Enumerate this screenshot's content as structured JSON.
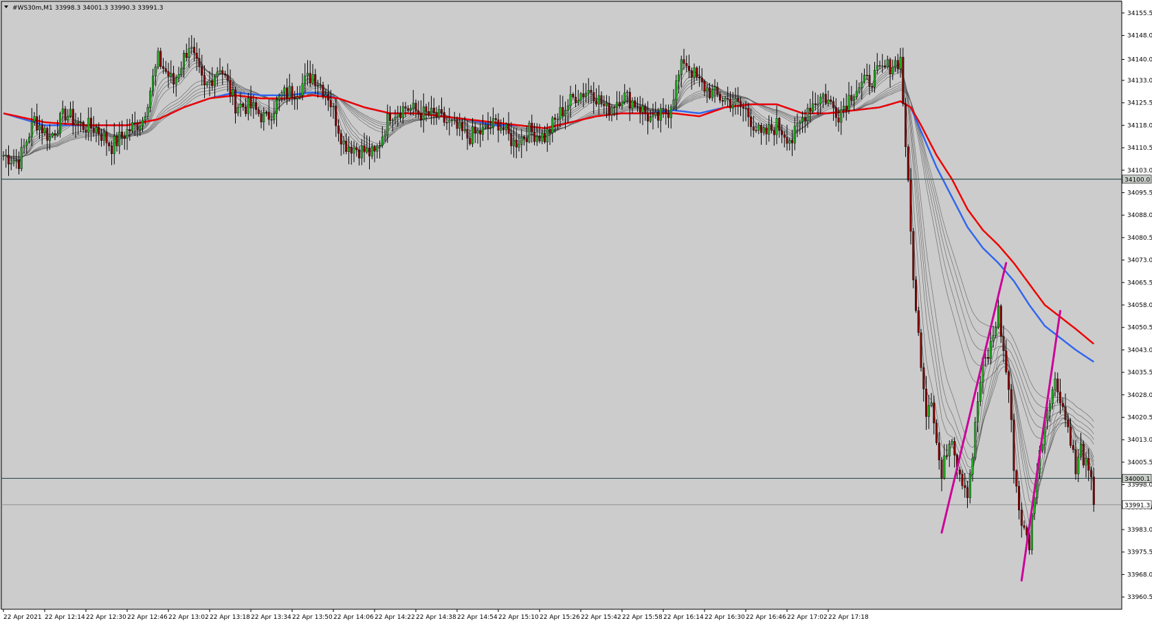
{
  "window": {
    "symbol_timeframe": "#WS30m,M1",
    "ohlc_readout": "33998.3 34001.3 33990.3 33991.3",
    "menu_icon": "triangle-down-icon"
  },
  "colors": {
    "background": "#cccccc",
    "ema_fast": "#ee0000",
    "ema_slow": "#3366ee",
    "guppy": "#555555",
    "bull_candle": "#22aa22",
    "bear_candle": "#880000",
    "wick": "#000000",
    "trendline": "#cc0099",
    "level_line": "#2f4f4f"
  },
  "chart_data": {
    "type": "candlestick",
    "title": "#WS30m,M1",
    "ylim": [
      33958.0,
      34158.0
    ],
    "y_ticks": [
      "34155.5",
      "34148.0",
      "34140.0",
      "34133.0",
      "34125.5",
      "34118.0",
      "34110.5",
      "34103.0",
      "34095.5",
      "34088.0",
      "34080.5",
      "34073.0",
      "34065.5",
      "34058.0",
      "34050.5",
      "34043.0",
      "34035.5",
      "34028.0",
      "34020.5",
      "34013.0",
      "34005.5",
      "33998.0",
      "33990.5",
      "33983.0",
      "33975.5",
      "33968.0",
      "33960.5"
    ],
    "x_ticks": [
      "22 Apr 2021",
      "22 Apr 12:14",
      "22 Apr 12:30",
      "22 Apr 12:46",
      "22 Apr 13:02",
      "22 Apr 13:18",
      "22 Apr 13:34",
      "22 Apr 13:50",
      "22 Apr 14:06",
      "22 Apr 14:22",
      "22 Apr 14:38",
      "22 Apr 14:54",
      "22 Apr 15:10",
      "22 Apr 15:26",
      "22 Apr 15:42",
      "22 Apr 15:58",
      "22 Apr 16:14",
      "22 Apr 16:30",
      "22 Apr 16:46",
      "22 Apr 17:02",
      "22 Apr 17:18"
    ],
    "bars_per_tick": 16,
    "horizontal_levels": [
      {
        "price": 34100.0,
        "label": "34100.0"
      },
      {
        "price": 34000.1,
        "label": "34000.1"
      }
    ],
    "current_price": {
      "price": 33991.3,
      "label": "33991.3"
    },
    "close_path": [
      [
        0,
        34108
      ],
      [
        6,
        34106
      ],
      [
        12,
        34120
      ],
      [
        18,
        34114
      ],
      [
        24,
        34122
      ],
      [
        30,
        34118
      ],
      [
        36,
        34117
      ],
      [
        42,
        34111
      ],
      [
        48,
        34116
      ],
      [
        54,
        34120
      ],
      [
        60,
        34140
      ],
      [
        66,
        34132
      ],
      [
        72,
        34145
      ],
      [
        78,
        34130
      ],
      [
        84,
        34138
      ],
      [
        90,
        34125
      ],
      [
        96,
        34124
      ],
      [
        102,
        34120
      ],
      [
        108,
        34128
      ],
      [
        114,
        34130
      ],
      [
        120,
        34135
      ],
      [
        126,
        34128
      ],
      [
        132,
        34112
      ],
      [
        138,
        34110
      ],
      [
        144,
        34108
      ],
      [
        150,
        34122
      ],
      [
        156,
        34124
      ],
      [
        162,
        34122
      ],
      [
        168,
        34121
      ],
      [
        174,
        34118
      ],
      [
        180,
        34114
      ],
      [
        186,
        34116
      ],
      [
        192,
        34119
      ],
      [
        198,
        34112
      ],
      [
        204,
        34116
      ],
      [
        210,
        34114
      ],
      [
        216,
        34122
      ],
      [
        222,
        34128
      ],
      [
        228,
        34130
      ],
      [
        234,
        34123
      ],
      [
        240,
        34128
      ],
      [
        246,
        34125
      ],
      [
        252,
        34119
      ],
      [
        258,
        34123
      ],
      [
        264,
        34140
      ],
      [
        270,
        34132
      ],
      [
        276,
        34128
      ],
      [
        282,
        34126
      ],
      [
        288,
        34123
      ],
      [
        294,
        34114
      ],
      [
        300,
        34118
      ],
      [
        306,
        34113
      ],
      [
        312,
        34124
      ],
      [
        318,
        34128
      ],
      [
        324,
        34122
      ],
      [
        330,
        34130
      ],
      [
        336,
        34133
      ],
      [
        342,
        34137
      ],
      [
        348,
        34140
      ],
      [
        350,
        34112
      ],
      [
        352,
        34082
      ],
      [
        354,
        34055
      ],
      [
        356,
        34040
      ],
      [
        358,
        34023
      ],
      [
        360,
        34028
      ],
      [
        362,
        34012
      ],
      [
        364,
        34000
      ],
      [
        366,
        34010
      ],
      [
        368,
        34015
      ],
      [
        370,
        34005
      ],
      [
        372,
        34000
      ],
      [
        374,
        33996
      ],
      [
        376,
        34008
      ],
      [
        378,
        34026
      ],
      [
        380,
        34038
      ],
      [
        382,
        34041
      ],
      [
        384,
        34048
      ],
      [
        386,
        34056
      ],
      [
        388,
        34042
      ],
      [
        390,
        34030
      ],
      [
        392,
        34005
      ],
      [
        394,
        33990
      ],
      [
        396,
        33982
      ],
      [
        398,
        33978
      ],
      [
        400,
        33996
      ],
      [
        402,
        34008
      ],
      [
        404,
        34020
      ],
      [
        406,
        34028
      ],
      [
        408,
        34032
      ],
      [
        410,
        34028
      ],
      [
        412,
        34020
      ],
      [
        414,
        34014
      ],
      [
        416,
        34002
      ],
      [
        418,
        34010
      ],
      [
        420,
        34004
      ],
      [
        422,
        33998
      ],
      [
        423,
        33991.3
      ]
    ],
    "ema_fast": [
      [
        0,
        34122
      ],
      [
        16,
        34119
      ],
      [
        32,
        34118
      ],
      [
        48,
        34118
      ],
      [
        60,
        34120
      ],
      [
        70,
        34124
      ],
      [
        80,
        34127
      ],
      [
        90,
        34128
      ],
      [
        100,
        34127
      ],
      [
        110,
        34127
      ],
      [
        120,
        34128
      ],
      [
        130,
        34127
      ],
      [
        140,
        34124
      ],
      [
        150,
        34122
      ],
      [
        160,
        34122
      ],
      [
        170,
        34121
      ],
      [
        180,
        34120
      ],
      [
        190,
        34119
      ],
      [
        200,
        34118
      ],
      [
        210,
        34117
      ],
      [
        220,
        34119
      ],
      [
        230,
        34121
      ],
      [
        240,
        34122
      ],
      [
        250,
        34122
      ],
      [
        260,
        34122
      ],
      [
        270,
        34121
      ],
      [
        280,
        34124
      ],
      [
        290,
        34125
      ],
      [
        300,
        34125
      ],
      [
        310,
        34122
      ],
      [
        320,
        34122
      ],
      [
        330,
        34123
      ],
      [
        340,
        34124
      ],
      [
        348,
        34126
      ],
      [
        352,
        34124
      ],
      [
        356,
        34118
      ],
      [
        362,
        34108
      ],
      [
        368,
        34100
      ],
      [
        374,
        34090
      ],
      [
        380,
        34083
      ],
      [
        386,
        34078
      ],
      [
        392,
        34072
      ],
      [
        398,
        34065
      ],
      [
        404,
        34058
      ],
      [
        410,
        34054
      ],
      [
        416,
        34050
      ],
      [
        423,
        34045
      ]
    ],
    "ema_slow": [
      [
        0,
        34122
      ],
      [
        16,
        34118
      ],
      [
        32,
        34118
      ],
      [
        48,
        34118
      ],
      [
        60,
        34120
      ],
      [
        70,
        34124
      ],
      [
        80,
        34127
      ],
      [
        90,
        34129
      ],
      [
        100,
        34128
      ],
      [
        110,
        34128
      ],
      [
        120,
        34129
      ],
      [
        130,
        34127
      ],
      [
        140,
        34124
      ],
      [
        150,
        34122
      ],
      [
        160,
        34122
      ],
      [
        170,
        34121
      ],
      [
        180,
        34120
      ],
      [
        190,
        34118
      ],
      [
        200,
        34118
      ],
      [
        210,
        34117
      ],
      [
        220,
        34119
      ],
      [
        230,
        34121
      ],
      [
        240,
        34122
      ],
      [
        250,
        34122
      ],
      [
        260,
        34123
      ],
      [
        270,
        34122
      ],
      [
        280,
        34124
      ],
      [
        290,
        34125
      ],
      [
        300,
        34125
      ],
      [
        310,
        34122
      ],
      [
        320,
        34122
      ],
      [
        330,
        34123
      ],
      [
        340,
        34124
      ],
      [
        348,
        34126
      ],
      [
        352,
        34124
      ],
      [
        356,
        34116
      ],
      [
        362,
        34104
      ],
      [
        368,
        34094
      ],
      [
        374,
        34084
      ],
      [
        380,
        34077
      ],
      [
        386,
        34072
      ],
      [
        392,
        34066
      ],
      [
        398,
        34058
      ],
      [
        404,
        34051
      ],
      [
        410,
        34047
      ],
      [
        416,
        34043
      ],
      [
        423,
        34039
      ]
    ],
    "trendlines": [
      {
        "x1": 364,
        "y1": 33982,
        "x2": 389,
        "y2": 34072
      },
      {
        "x1": 395,
        "y1": 33966,
        "x2": 410,
        "y2": 34056
      }
    ]
  }
}
